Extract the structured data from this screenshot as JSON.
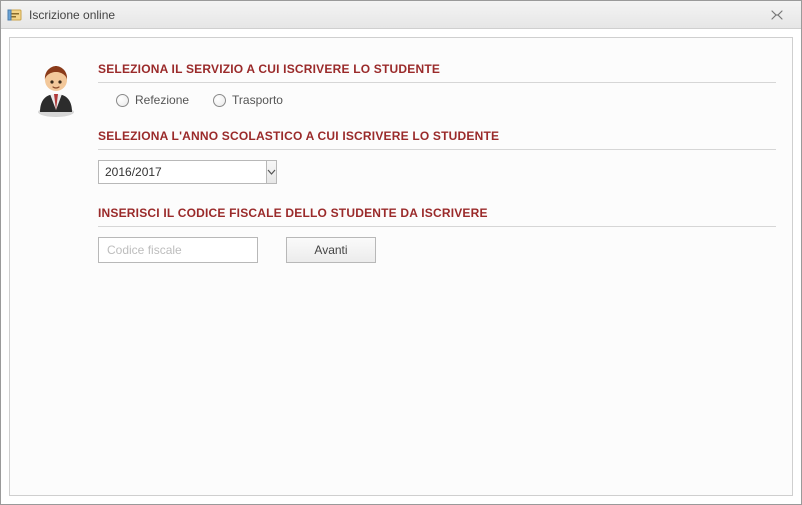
{
  "window": {
    "title": "Iscrizione online"
  },
  "sections": {
    "service_header": "SELEZIONA IL SERVIZIO A CUI ISCRIVERE LO STUDENTE",
    "year_header": "SELEZIONA L'ANNO SCOLASTICO A CUI ISCRIVERE LO STUDENTE",
    "cf_header": "INSERISCI IL CODICE FISCALE DELLO STUDENTE DA ISCRIVERE"
  },
  "service": {
    "options": [
      {
        "label": "Refezione"
      },
      {
        "label": "Trasporto"
      }
    ]
  },
  "year": {
    "selected": "2016/2017"
  },
  "cf": {
    "placeholder": "Codice fiscale",
    "value": ""
  },
  "buttons": {
    "next": "Avanti"
  },
  "colors": {
    "accent": "#9a2a2a"
  }
}
